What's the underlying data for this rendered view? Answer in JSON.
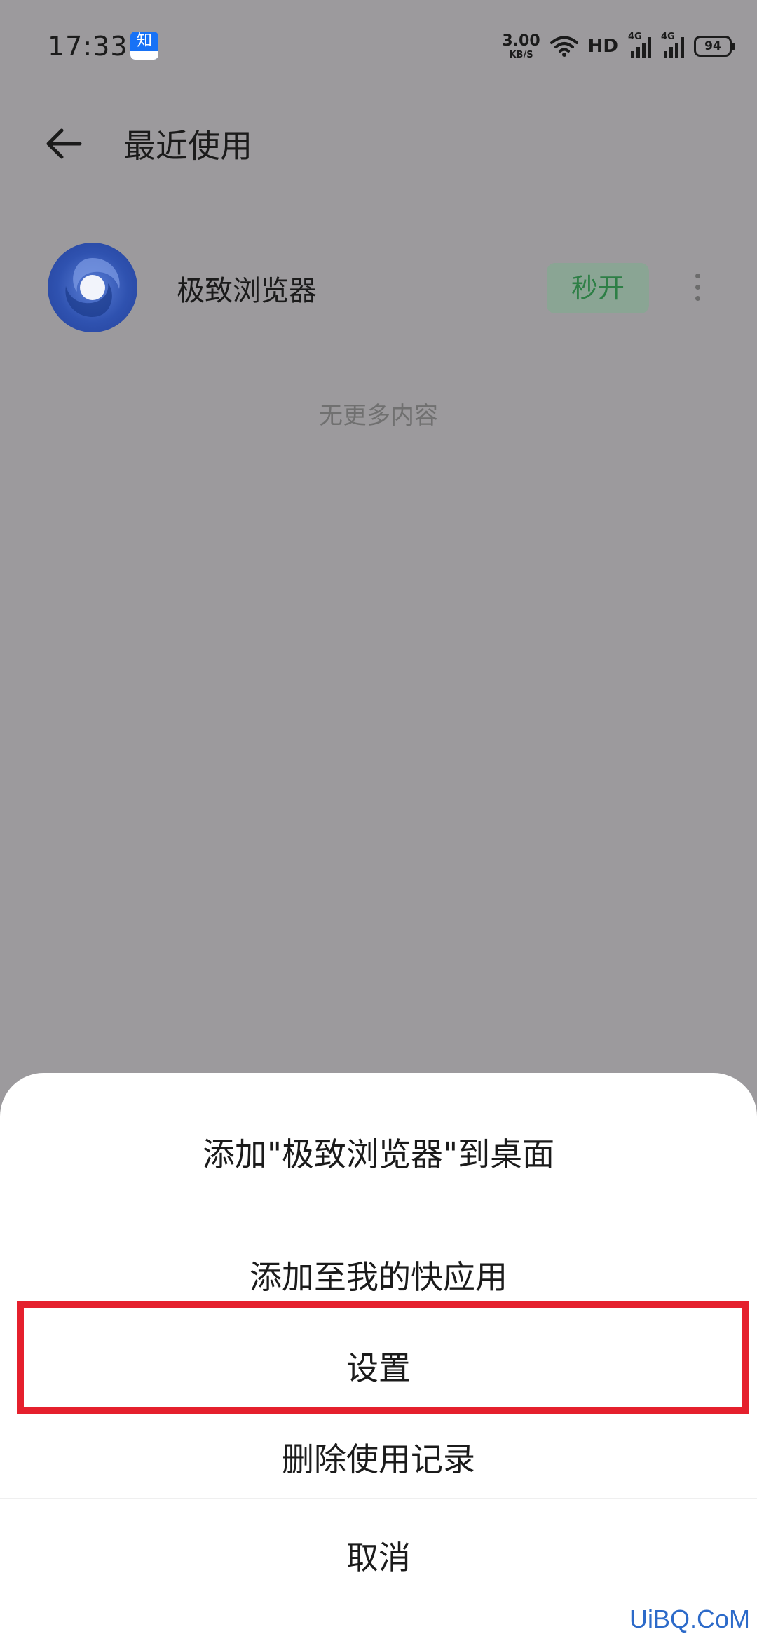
{
  "status_bar": {
    "time": "17:33",
    "notification_icon": "知",
    "net_speed_value": "3.00",
    "net_speed_unit": "KB/S",
    "hd_label": "HD",
    "signal_1_label": "4G",
    "signal_2_label": "4G",
    "battery_level": "94",
    "icons": [
      "zhihu-app-icon",
      "wifi-icon",
      "hd-voice-icon",
      "signal-icon",
      "signal-icon",
      "battery-icon"
    ]
  },
  "header": {
    "back_icon": "arrow-left-icon",
    "title": "最近使用"
  },
  "recent_app": {
    "icon": "browser-swirl-icon",
    "name": "极致浏览器",
    "open_button_label": "秒开",
    "more_icon": "vertical-ellipsis-icon",
    "open_button_text_color": "#2e7f46"
  },
  "empty_text": "无更多内容",
  "action_sheet": {
    "items": [
      {
        "label": "添加\"极致浏览器\"到桌面"
      },
      {
        "label": "添加至我的快应用"
      },
      {
        "label": "设置",
        "highlighted": true
      },
      {
        "label": "删除使用记录"
      }
    ],
    "cancel_label": "取消",
    "highlight_color": "#e5202d"
  },
  "watermark": "UiBQ.CoM"
}
